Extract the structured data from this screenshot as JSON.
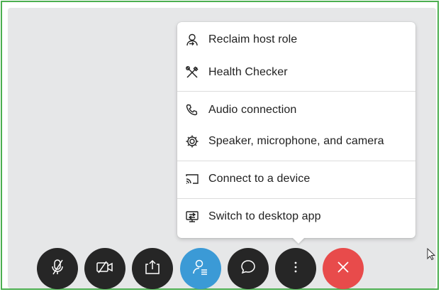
{
  "menu": {
    "items": [
      {
        "label": "Reclaim host role",
        "icon": "reclaim-host-icon"
      },
      {
        "label": "Health Checker",
        "icon": "tools-icon"
      },
      {
        "label": "Audio connection",
        "icon": "phone-icon"
      },
      {
        "label": "Speaker, microphone, and camera",
        "icon": "gear-icon"
      },
      {
        "label": "Connect to a device",
        "icon": "cast-icon"
      },
      {
        "label": "Switch to desktop app",
        "icon": "desktop-app-icon"
      }
    ]
  },
  "controls": [
    {
      "name": "mute",
      "icon": "mic-muted-icon",
      "color": "#262626"
    },
    {
      "name": "video",
      "icon": "video-off-icon",
      "color": "#262626"
    },
    {
      "name": "share",
      "icon": "share-icon",
      "color": "#262626"
    },
    {
      "name": "participants",
      "icon": "participants-icon",
      "color": "#3b9ad6"
    },
    {
      "name": "chat",
      "icon": "chat-icon",
      "color": "#262626"
    },
    {
      "name": "more",
      "icon": "more-icon",
      "color": "#262626"
    },
    {
      "name": "leave",
      "icon": "close-icon",
      "color": "#e84b4b"
    }
  ],
  "colors": {
    "frame_border": "#4caf50",
    "stage_bg": "#e6e7e8",
    "control_dark": "#262626",
    "participants_blue": "#3b9ad6",
    "leave_red": "#e84b4b"
  }
}
